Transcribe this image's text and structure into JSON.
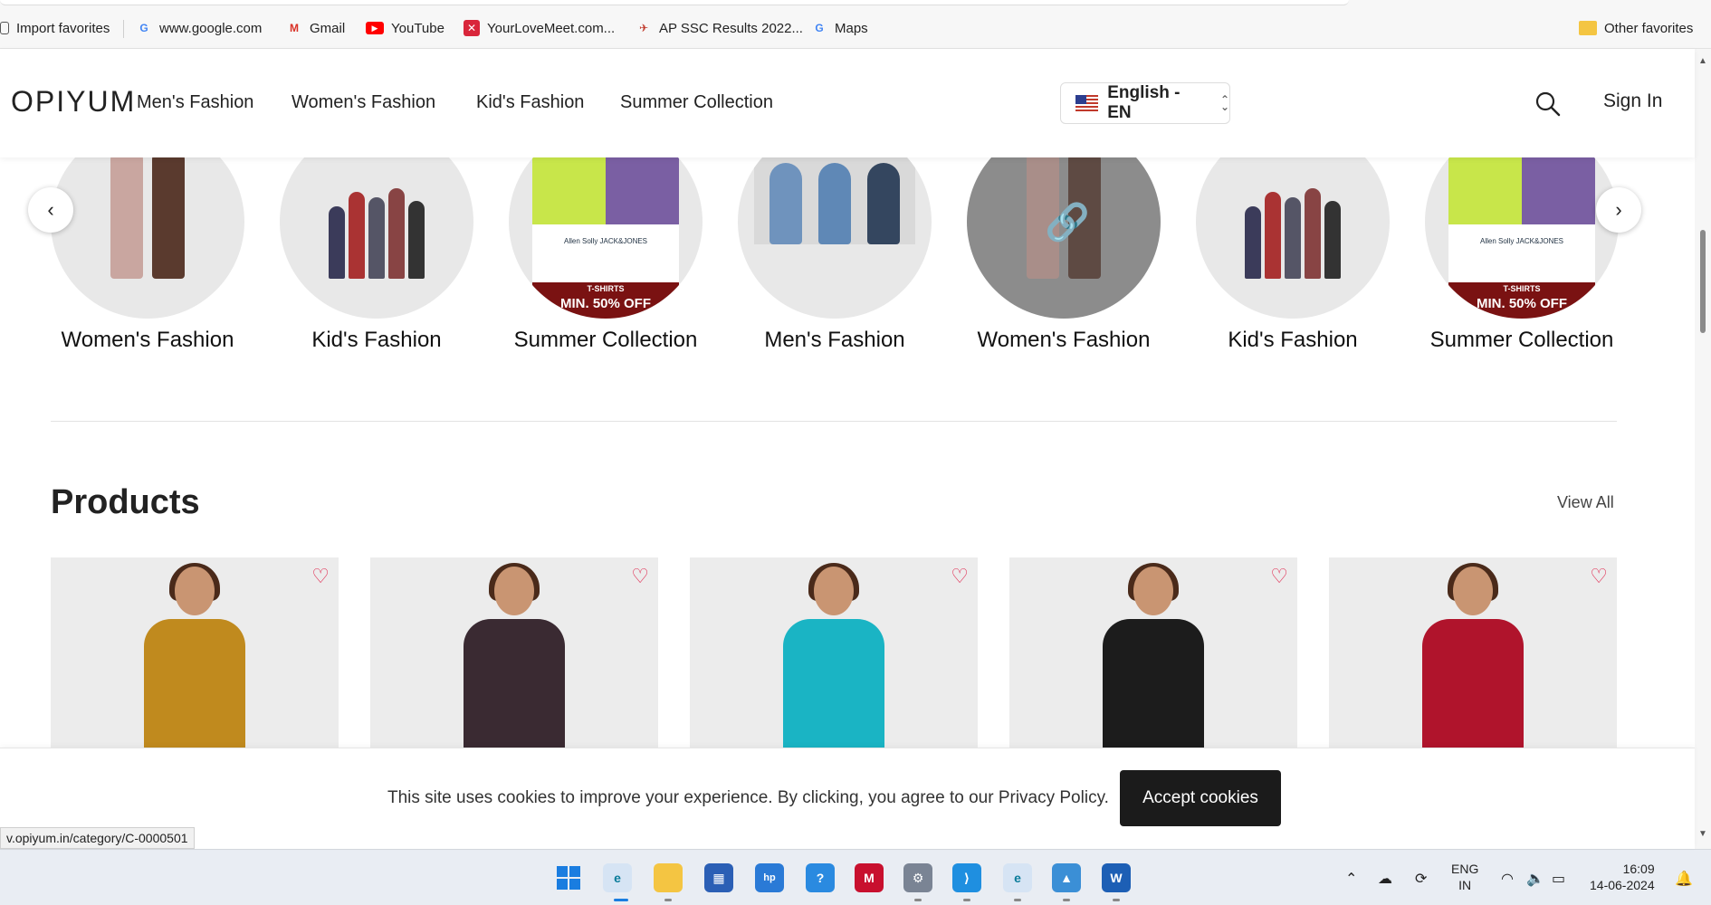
{
  "favorites": {
    "items": [
      {
        "label": "Import favorites",
        "icon": "import-icon"
      },
      {
        "label": "www.google.com",
        "icon": "google-icon"
      },
      {
        "label": "Gmail",
        "icon": "gmail-icon"
      },
      {
        "label": "YouTube",
        "icon": "youtube-icon"
      },
      {
        "label": "YourLoveMeet.com...",
        "icon": "site-icon"
      },
      {
        "label": "AP SSC Results 2022...",
        "icon": "site-icon"
      },
      {
        "label": "Maps",
        "icon": "google-icon"
      }
    ],
    "other": "Other favorites"
  },
  "header": {
    "logo": "OPIYUM",
    "nav": [
      "Men's Fashion",
      "Women's Fashion",
      "Kid's Fashion",
      "Summer Collection"
    ],
    "language": "English - EN",
    "signin": "Sign In"
  },
  "categories": [
    {
      "label": "Women's Fashion",
      "kind": "women"
    },
    {
      "label": "Kid's Fashion",
      "kind": "kids"
    },
    {
      "label": "Summer Collection",
      "kind": "summer"
    },
    {
      "label": "Men's Fashion",
      "kind": "men"
    },
    {
      "label": "Women's Fashion",
      "kind": "women-hover"
    },
    {
      "label": "Kid's Fashion",
      "kind": "kids"
    },
    {
      "label": "Summer Collection",
      "kind": "summer"
    }
  ],
  "promo": {
    "line1": "T-SHIRTS",
    "line2": "MIN. 50% OFF",
    "brands": "Allen Solly   JACK&JONES"
  },
  "products": {
    "title": "Products",
    "view_all": "View All",
    "cards": [
      {
        "color": "#c08a1e",
        "bg": "#eeeeee"
      },
      {
        "color": "#3a2a32",
        "bg": "#eeeeee"
      },
      {
        "color": "#1ab4c4",
        "bg": "#ececec"
      },
      {
        "color": "#1c1c1c",
        "bg": "#eeeeee"
      },
      {
        "color": "#b0142c",
        "bg": "#eeeeee"
      }
    ]
  },
  "cookie": {
    "text": "This site uses cookies to improve your experience. By clicking, you agree to our Privacy Policy.",
    "button": "Accept cookies"
  },
  "status_url": "v.opiyum.in/category/C-0000501",
  "taskbar": {
    "lang_top": "ENG",
    "lang_bottom": "IN",
    "time": "16:09",
    "date": "14-06-2024"
  }
}
